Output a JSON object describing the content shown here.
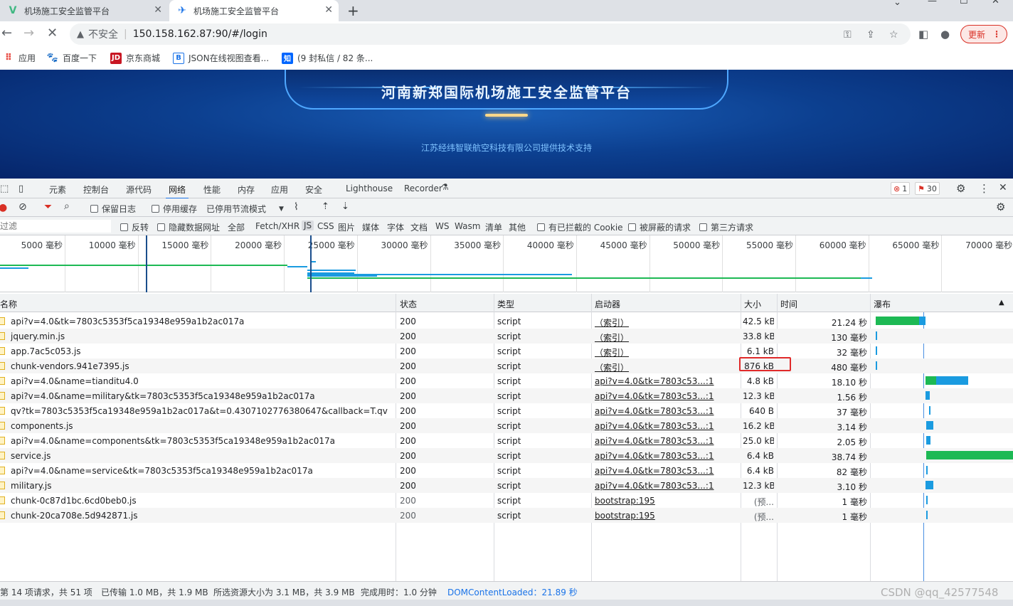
{
  "browser": {
    "tabs": [
      {
        "title": "机场施工安全监管平台",
        "active": false
      },
      {
        "title": "机场施工安全监管平台",
        "active": true
      }
    ],
    "url_prefix": "不安全",
    "url": "150.158.162.87:90/#/login",
    "update_label": "更新",
    "bookmarks": [
      {
        "label": "应用",
        "icon": "apps-grid-icon"
      },
      {
        "label": "百度一下",
        "icon": "baidu-paw-icon"
      },
      {
        "label": "京东商城",
        "icon": "jd-logo-icon"
      },
      {
        "label": "JSON在线视图查看...",
        "icon": "json-viewer-icon"
      },
      {
        "label": "(9 封私信 / 82 条...",
        "icon": "zhihu-icon"
      }
    ]
  },
  "page": {
    "title": "河南新郑国际机场施工安全监管平台",
    "subtitle": "江苏经纬智联航空科技有限公司提供技术支持"
  },
  "devtools": {
    "tabs": [
      "元素",
      "控制台",
      "源代码",
      "网络",
      "性能",
      "内存",
      "应用",
      "安全",
      "Lighthouse",
      "Recorder"
    ],
    "active_tab": "网络",
    "error_count": "1",
    "warning_count": "30",
    "network_toolbar": {
      "preserve_log": "保留日志",
      "disable_cache": "停用缓存",
      "throttling": "已停用节流模式"
    },
    "filter": {
      "placeholder": "过滤",
      "invert": "反转",
      "hide_data_urls": "隐藏数据网址",
      "types": [
        "全部",
        "Fetch/XHR",
        "JS",
        "CSS",
        "图片",
        "媒体",
        "字体",
        "文档",
        "WS",
        "Wasm",
        "清单",
        "其他"
      ],
      "selected_type": "JS",
      "blocked_cookies": "有已拦截的 Cookie",
      "blocked_requests": "被屏蔽的请求",
      "third_party": "第三方请求"
    },
    "overview_ticks": [
      "5000 毫秒",
      "10000 毫秒",
      "15000 毫秒",
      "20000 毫秒",
      "25000 毫秒",
      "30000 毫秒",
      "35000 毫秒",
      "40000 毫秒",
      "45000 毫秒",
      "50000 毫秒",
      "55000 毫秒",
      "60000 毫秒",
      "65000 毫秒",
      "70000 毫秒"
    ],
    "columns": {
      "name": "名称",
      "status": "状态",
      "type": "类型",
      "initiator": "启动器",
      "size": "大小",
      "time": "时间",
      "waterfall": "瀑布"
    },
    "rows": [
      {
        "name": "api?v=4.0&tk=7803c5353f5ca19348e959a1b2ac017a",
        "status": "200",
        "type": "script",
        "initiator": "（索引）",
        "size": "42.5 kB",
        "time": "21.24 秒",
        "wf_start_ms": 0,
        "wf_wait_ms": 18500,
        "wf_dl_ms": 2740
      },
      {
        "name": "jquery.min.js",
        "status": "200",
        "type": "script",
        "initiator": "（索引）",
        "size": "33.8 kB",
        "time": "130 毫秒",
        "wf_start_ms": 0,
        "wf_wait_ms": 0,
        "wf_dl_ms": 130
      },
      {
        "name": "app.7ac5c053.js",
        "status": "200",
        "type": "script",
        "initiator": "（索引）",
        "size": "6.1 kB",
        "time": "32 毫秒",
        "wf_start_ms": 0,
        "wf_wait_ms": 0,
        "wf_dl_ms": 32
      },
      {
        "name": "chunk-vendors.941e7395.js",
        "status": "200",
        "type": "script",
        "initiator": "（索引）",
        "size": "876 kB",
        "time": "480 毫秒",
        "wf_start_ms": 0,
        "wf_wait_ms": 0,
        "wf_dl_ms": 480
      },
      {
        "name": "api?v=4.0&name=tianditu4.0",
        "status": "200",
        "type": "script",
        "initiator": "api?v=4.0&tk=7803c53...:1",
        "size": "4.8 kB",
        "time": "18.10 秒",
        "wf_start_ms": 21300,
        "wf_wait_ms": 4500,
        "wf_dl_ms": 13600
      },
      {
        "name": "api?v=4.0&name=military&tk=7803c5353f5ca19348e959a1b2ac017a",
        "status": "200",
        "type": "script",
        "initiator": "api?v=4.0&tk=7803c53...:1",
        "size": "12.3 kB",
        "time": "1.56 秒",
        "wf_start_ms": 21300,
        "wf_wait_ms": 0,
        "wf_dl_ms": 1560
      },
      {
        "name": "qv?tk=7803c5353f5ca19348e959a1b2ac017a&t=0.4307102776380647&callback=T.qv",
        "status": "200",
        "type": "script",
        "initiator": "api?v=4.0&tk=7803c53...:1",
        "size": "640 B",
        "time": "37 毫秒",
        "wf_start_ms": 22800,
        "wf_wait_ms": 0,
        "wf_dl_ms": 300
      },
      {
        "name": "components.js",
        "status": "200",
        "type": "script",
        "initiator": "api?v=4.0&tk=7803c53...:1",
        "size": "16.2 kB",
        "time": "3.14 秒",
        "wf_start_ms": 21400,
        "wf_wait_ms": 0,
        "wf_dl_ms": 3140
      },
      {
        "name": "api?v=4.0&name=components&tk=7803c5353f5ca19348e959a1b2ac017a",
        "status": "200",
        "type": "script",
        "initiator": "api?v=4.0&tk=7803c53...:1",
        "size": "25.0 kB",
        "time": "2.05 秒",
        "wf_start_ms": 21400,
        "wf_wait_ms": 0,
        "wf_dl_ms": 2050
      },
      {
        "name": "service.js",
        "status": "200",
        "type": "script",
        "initiator": "api?v=4.0&tk=7803c53...:1",
        "size": "6.4 kB",
        "time": "38.74 秒",
        "wf_start_ms": 21400,
        "wf_wait_ms": 38740,
        "wf_dl_ms": 0
      },
      {
        "name": "api?v=4.0&name=service&tk=7803c5353f5ca19348e959a1b2ac017a",
        "status": "200",
        "type": "script",
        "initiator": "api?v=4.0&tk=7803c53...:1",
        "size": "6.4 kB",
        "time": "82 毫秒",
        "wf_start_ms": 21400,
        "wf_wait_ms": 0,
        "wf_dl_ms": 82
      },
      {
        "name": "military.js",
        "status": "200",
        "type": "script",
        "initiator": "api?v=4.0&tk=7803c53...:1",
        "size": "12.3 kB",
        "time": "3.10 秒",
        "wf_start_ms": 21300,
        "wf_wait_ms": 0,
        "wf_dl_ms": 3100
      },
      {
        "name": "chunk-0c87d1bc.6cd0beb0.js",
        "status": "200",
        "type": "script",
        "initiator": "bootstrap:195",
        "size": "(预...",
        "time": "1 毫秒",
        "wf_start_ms": 21500,
        "wf_wait_ms": 0,
        "wf_dl_ms": 1
      },
      {
        "name": "chunk-20ca708e.5d942871.js",
        "status": "200",
        "type": "script",
        "initiator": "bootstrap:195",
        "size": "(预...",
        "time": "1 毫秒",
        "wf_start_ms": 21500,
        "wf_wait_ms": 0,
        "wf_dl_ms": 1
      }
    ],
    "status_bar": {
      "requests": "第 14 项请求，共 51 项",
      "transferred": "已传输 1.0 MB，共 1.9 MB",
      "resources": "所选资源大小为 3.1 MB，共 3.9 MB",
      "finish": "完成用时：1.0 分钟",
      "dcl": "DOMContentLoaded：21.89 秒"
    },
    "colors": {
      "waiting": "#1db954",
      "download": "#1a9be0",
      "highlight": "#e02a2a",
      "accent": "#1a73e8"
    }
  },
  "watermark": "CSDN @qq_42577548"
}
